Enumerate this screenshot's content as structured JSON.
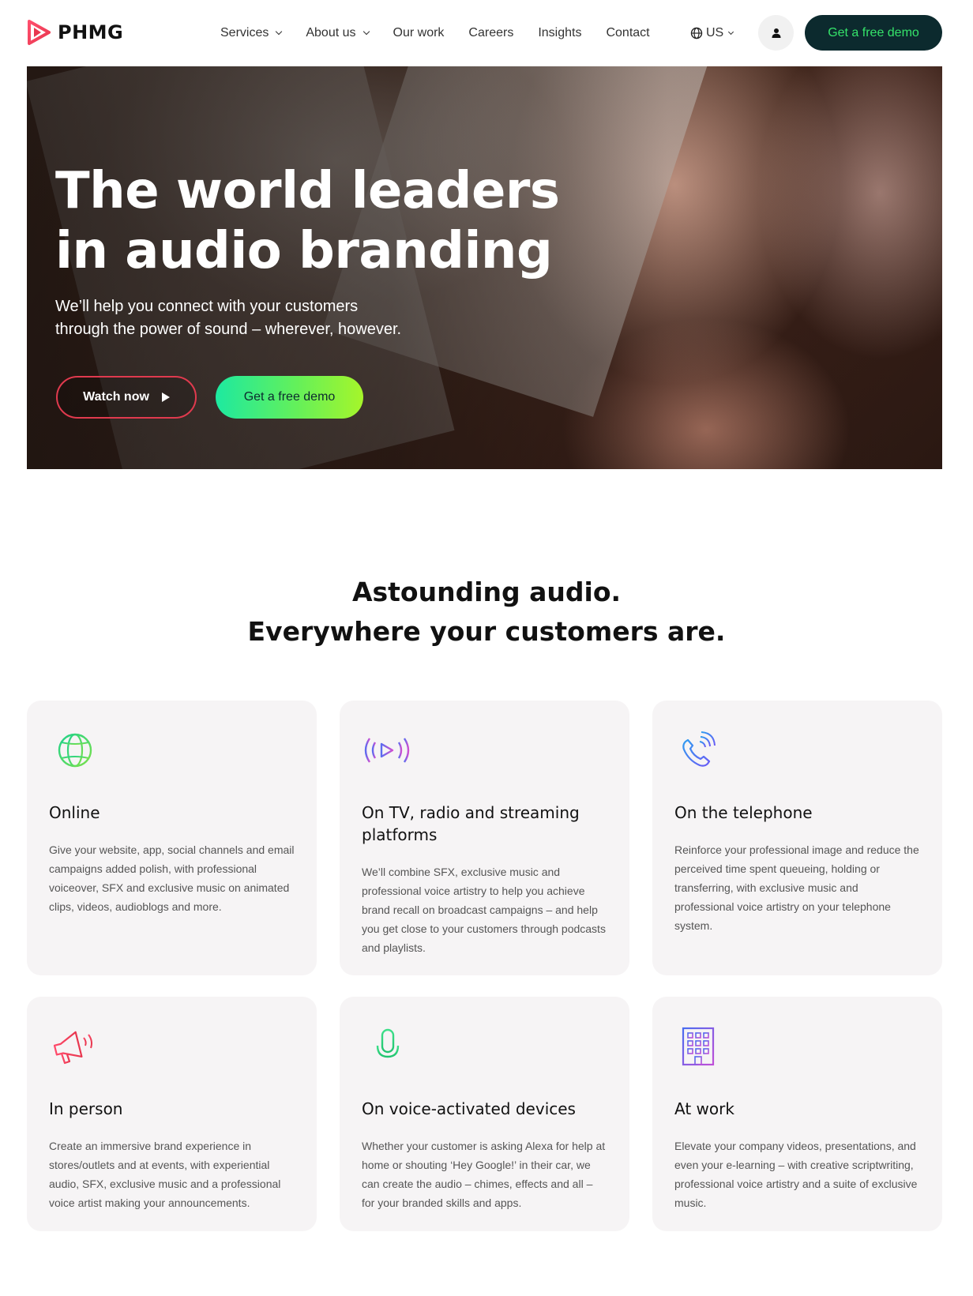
{
  "brand": {
    "name": "PHMG",
    "accent": "#e8374f",
    "dark": "#0c2a2e",
    "green": "#35e36a"
  },
  "nav": {
    "items": [
      {
        "label": "Services",
        "dropdown": true
      },
      {
        "label": "About us",
        "dropdown": true
      },
      {
        "label": "Our work",
        "dropdown": false
      },
      {
        "label": "Careers",
        "dropdown": false
      },
      {
        "label": "Insights",
        "dropdown": false
      },
      {
        "label": "Contact",
        "dropdown": false
      }
    ],
    "language": "US",
    "language_icon": "globe-icon",
    "account_icon": "user-icon",
    "cta": "Get a free demo"
  },
  "hero": {
    "title_line1": "The world leaders",
    "title_line2": "in audio branding",
    "subtitle_line1": "We’ll help you connect with your customers",
    "subtitle_line2": "through the power of sound – wherever, however.",
    "watch_label": "Watch now",
    "watch_icon": "play-icon",
    "demo_label": "Get a free demo"
  },
  "section": {
    "title_line1": "Astounding audio.",
    "title_line2": "Everywhere your customers are."
  },
  "cards": [
    {
      "title": "Online",
      "icon": "globe-icon",
      "text": "Give your website, app, social channels and email campaigns added polish, with professional voiceover, SFX and exclusive music on animated clips, videos, audioblogs and more."
    },
    {
      "title": "On TV, radio and streaming platforms",
      "icon": "broadcast-play-icon",
      "text": "We’ll combine SFX, exclusive music and professional voice artistry to help you achieve brand recall on broadcast campaigns – and help you get close to your customers through podcasts and playlists."
    },
    {
      "title": "On the telephone",
      "icon": "phone-icon",
      "text": "Reinforce your professional image and reduce the perceived time spent queueing, holding or transferring, with exclusive music and professional voice artistry on your telephone system."
    },
    {
      "title": "In person",
      "icon": "megaphone-icon",
      "text": "Create an immersive brand experience in stores/outlets and at events, with experiential audio, SFX, exclusive music and a professional voice artist making your announcements."
    },
    {
      "title": "On voice-activated devices",
      "icon": "microphone-icon",
      "text": "Whether your customer is asking Alexa for help at home or shouting ‘Hey Google!’ in their car, we can create the audio – chimes, effects and all – for your branded skills and apps."
    },
    {
      "title": "At work",
      "icon": "office-building-icon",
      "text": "Elevate your company videos, presentations, and even your e-learning – with creative scriptwriting, professional voice artistry and a suite of exclusive music."
    }
  ]
}
